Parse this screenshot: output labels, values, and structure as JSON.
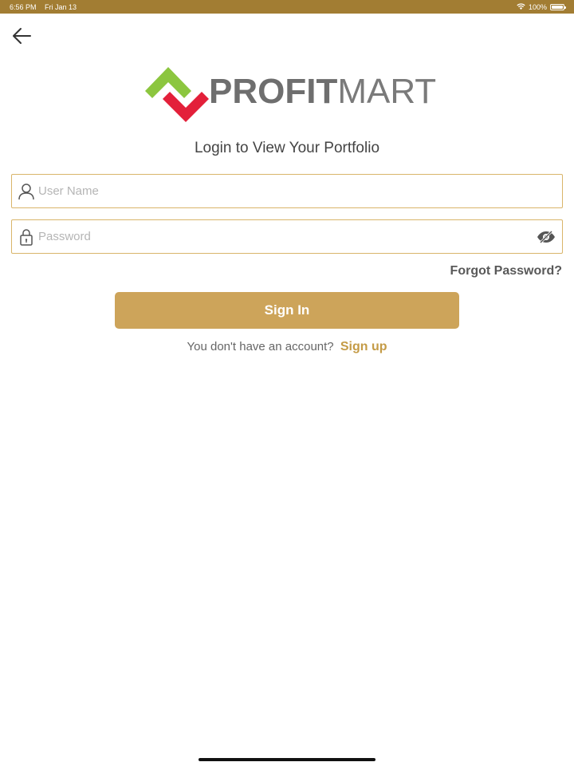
{
  "status_bar": {
    "time": "6:56 PM",
    "date": "Fri Jan 13",
    "battery": "100%",
    "wifi_icon": "wifi-icon",
    "battery_icon": "battery-icon"
  },
  "nav": {
    "back_icon": "arrow-left-icon"
  },
  "logo": {
    "bold_text": "PROFIT",
    "light_text": "MART",
    "colors": {
      "green": "#8cc63f",
      "red": "#e3203a",
      "gray": "#6e6e6e"
    }
  },
  "title": "Login to View Your Portfolio",
  "form": {
    "username": {
      "placeholder": "User Name",
      "value": "",
      "icon": "user-icon"
    },
    "password": {
      "placeholder": "Password",
      "value": "",
      "icon": "lock-icon",
      "toggle_icon": "eye-slash-icon"
    },
    "forgot_label": "Forgot Password?",
    "signin_label": "Sign In"
  },
  "signup": {
    "prompt": "You don't have an account?",
    "link_label": "Sign up"
  },
  "colors": {
    "accent": "#cda45a",
    "status_bar": "#a27d33",
    "field_border": "#d9b56a"
  }
}
